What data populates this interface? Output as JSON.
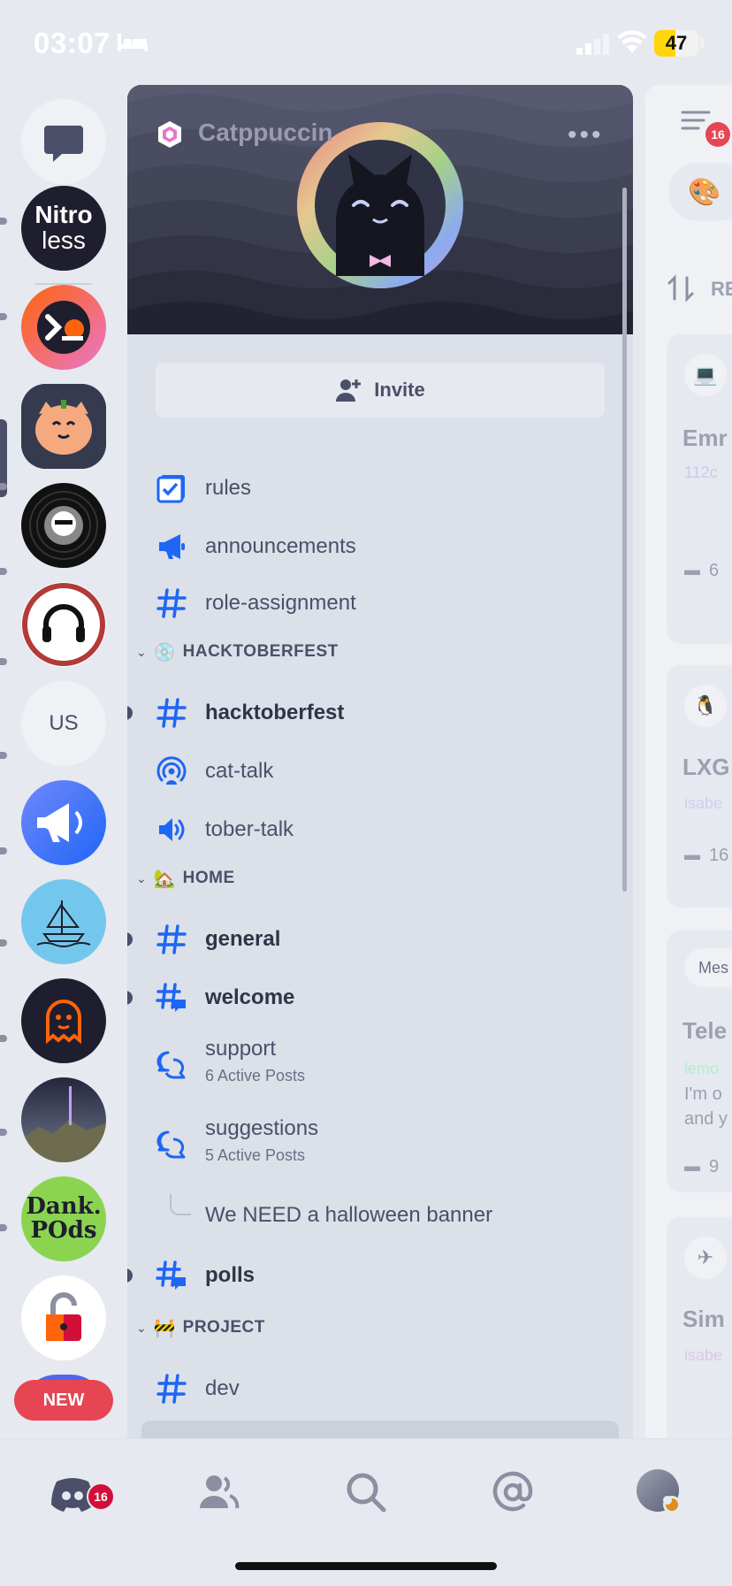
{
  "status_bar": {
    "time": "03:07",
    "battery": "47",
    "battery_level": 0.47
  },
  "server": {
    "name": "Catppuccin",
    "invite_label": "Invite"
  },
  "rail": {
    "dm_icon": "chat-bubble-icon",
    "servers": [
      {
        "name": "nitroless",
        "line1": "Nitro",
        "line2": "less"
      },
      {
        "name": "halloween-terminal"
      },
      {
        "name": "pumpkin-cat"
      },
      {
        "name": "vinyl-record"
      },
      {
        "name": "headphones"
      },
      {
        "name": "us-server",
        "label": "US"
      },
      {
        "name": "megaphone"
      },
      {
        "name": "ship-sketch"
      },
      {
        "name": "ghost"
      },
      {
        "name": "night-landscape"
      },
      {
        "name": "dank-pods",
        "line1": "Dank.",
        "line2": "POds"
      },
      {
        "name": "padlock"
      }
    ],
    "new_badge": "NEW"
  },
  "channels": {
    "top": [
      {
        "icon": "rules-checkbox-icon",
        "label": "rules"
      },
      {
        "icon": "megaphone-icon",
        "label": "announcements"
      },
      {
        "icon": "hash-icon",
        "label": "role-assignment"
      }
    ],
    "categories": [
      {
        "label": "HACKTOBERFEST",
        "emoji": "💿",
        "items": [
          {
            "icon": "hash-icon",
            "label": "hacktoberfest",
            "unread": true
          },
          {
            "icon": "stage-icon",
            "label": "cat-talk"
          },
          {
            "icon": "speaker-icon",
            "label": "tober-talk"
          }
        ]
      },
      {
        "label": "HOME",
        "emoji": "🏡",
        "items": [
          {
            "icon": "hash-icon",
            "label": "general",
            "unread": true
          },
          {
            "icon": "hash-thread-icon",
            "label": "welcome",
            "unread": true
          },
          {
            "icon": "forum-icon",
            "label": "support",
            "sub": "6 Active Posts"
          },
          {
            "icon": "forum-icon",
            "label": "suggestions",
            "sub": "5 Active Posts"
          },
          {
            "icon": "thread-icon",
            "label": "We NEED a halloween banner"
          },
          {
            "icon": "hash-thread-icon",
            "label": "polls",
            "unread": true
          }
        ]
      },
      {
        "label": "PROJECT",
        "emoji": "🚧",
        "items": [
          {
            "icon": "hash-icon",
            "label": "dev"
          }
        ]
      }
    ]
  },
  "peek": {
    "badge": "16",
    "sort_label": "RE",
    "cards": [
      {
        "title": "Emr",
        "sub": "112c",
        "count": "6"
      },
      {
        "title": "LXG",
        "sub": "isabe",
        "count": "16"
      },
      {
        "tag": "Mes",
        "title": "Tele",
        "sub": "lemo",
        "line2": "I'm o",
        "line3": "and y",
        "count": "9"
      },
      {
        "title": "Sim",
        "sub": "isabe"
      }
    ]
  },
  "tabbar": {
    "badge": "16",
    "tabs": [
      "home-icon",
      "friends-icon",
      "search-icon",
      "mentions-icon",
      "profile-avatar"
    ]
  },
  "colors": {
    "accent": "#1e66f5",
    "badge": "#d20f39",
    "text": "#4c4f69",
    "panel": "#dce0e8"
  }
}
